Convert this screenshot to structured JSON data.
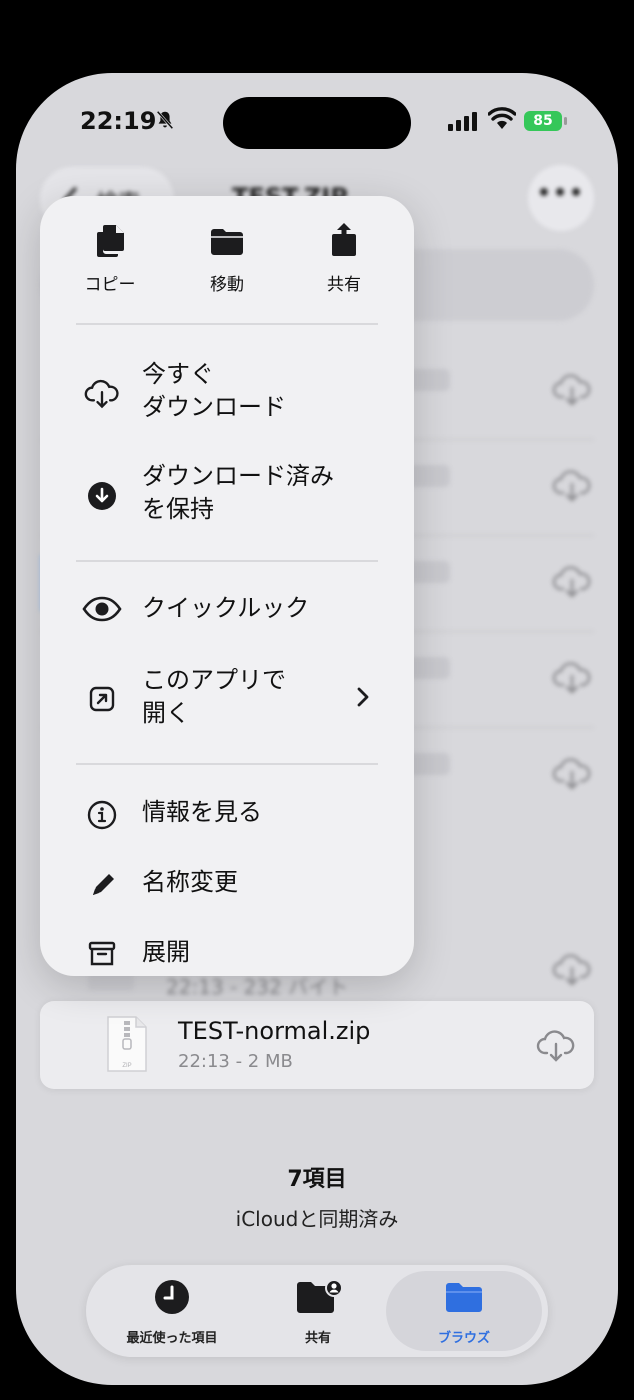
{
  "status_bar": {
    "time": "22:19",
    "battery": "85"
  },
  "nav": {
    "back_label": "検索",
    "title": "TEST.ZIP"
  },
  "context_menu": {
    "quick_actions": [
      {
        "label": "コピー",
        "icon": "copy-icon"
      },
      {
        "label": "移動",
        "icon": "folder-icon"
      },
      {
        "label": "共有",
        "icon": "share-icon"
      }
    ],
    "items": [
      {
        "line1": "今すぐ",
        "line2": "ダウンロード",
        "icon": "cloud-download-icon"
      },
      {
        "line1": "ダウンロード済み",
        "line2": "を保持",
        "icon": "keep-downloaded-icon"
      },
      {
        "line1": "クイックルック",
        "icon": "eye-icon"
      },
      {
        "line1": "このアプリで",
        "line2": "開く",
        "icon": "open-in-app-icon"
      },
      {
        "line1": "情報を見る",
        "icon": "info-icon"
      },
      {
        "line1": "名称変更",
        "icon": "pencil-icon"
      },
      {
        "line1": "展開",
        "icon": "archive-icon"
      }
    ]
  },
  "partial_row": {
    "meta": "22:13 - 232 バイト"
  },
  "selected_file": {
    "name": "TEST-normal.zip",
    "meta": "22:13 - 2 MB"
  },
  "footer": {
    "count": "7項目",
    "sync": "iCloudと同期済み"
  },
  "tabs": [
    {
      "label": "最近使った項目",
      "icon": "clock-icon"
    },
    {
      "label": "共有",
      "icon": "shared-folder-icon"
    },
    {
      "label": "ブラウズ",
      "icon": "folder-icon",
      "active": true
    }
  ],
  "colors": {
    "accent": "#2f6fe0",
    "battery": "#35c759"
  }
}
